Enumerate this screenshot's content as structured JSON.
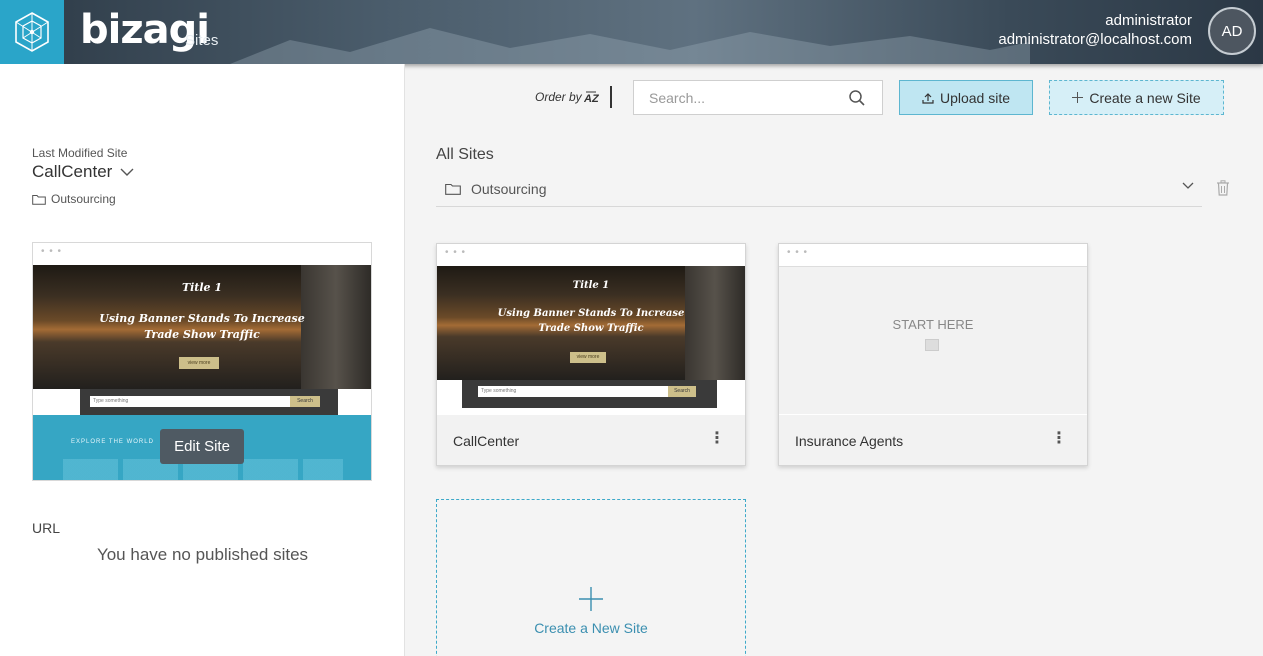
{
  "header": {
    "brand": "bizagi",
    "subtitle": "Sites",
    "user_name": "administrator",
    "user_email": "administrator@localhost.com",
    "avatar_initials": "AD",
    "accent_color": "#2aa5c9"
  },
  "left_panel": {
    "last_modified_label": "Last Modified Site",
    "site_name": "CallCenter",
    "folder": "Outsourcing",
    "edit_button": "Edit Site",
    "url_label": "URL",
    "no_published": "You have no published sites",
    "preview": {
      "title": "Title 1",
      "headline": "Using Banner Stands To Increase Trade Show Traffic",
      "button": "view more",
      "search_placeholder": "Type something",
      "search_button": "Search",
      "section": "EXPLORE THE WORLD"
    }
  },
  "toolbar": {
    "order_by_label": "Order by",
    "order_by_icon": "A-Z",
    "search_placeholder": "Search...",
    "upload_label": "Upload site",
    "create_label": "Create a new Site"
  },
  "main": {
    "section_title": "All Sites",
    "folder_name": "Outsourcing",
    "cards": [
      {
        "name": "CallCenter",
        "preview_title": "Title 1",
        "preview_headline": "Using Banner Stands To Increase Trade Show Traffic",
        "preview_button": "view more",
        "preview_search": "Type something",
        "preview_search_button": "Search"
      },
      {
        "name": "Insurance Agents",
        "preview_text": "START HERE"
      }
    ],
    "new_site_label": "Create a New Site"
  }
}
